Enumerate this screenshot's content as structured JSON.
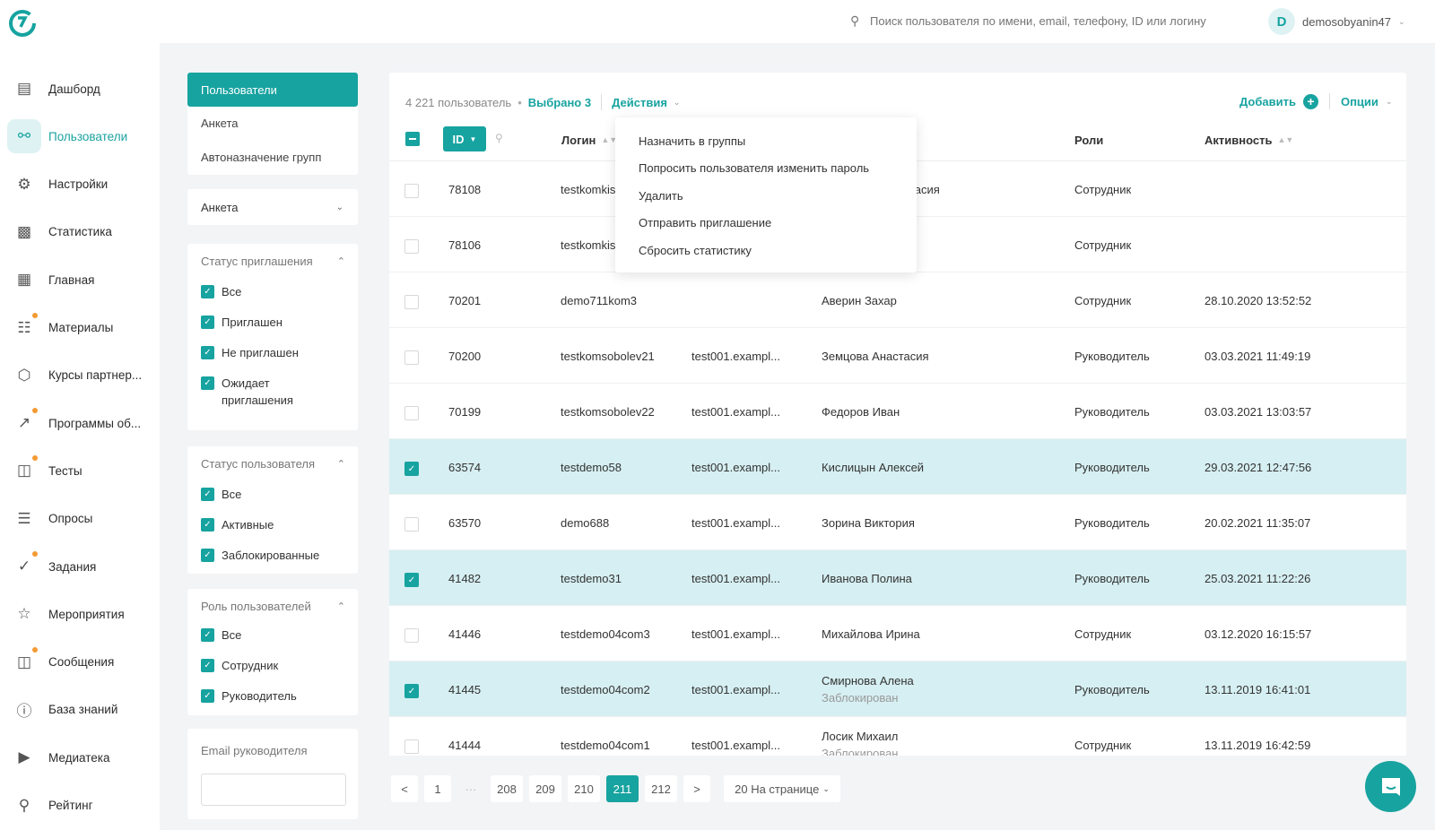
{
  "colors": {
    "accent": "#17a3a0",
    "selected_row": "#d6eff2",
    "badge_dot": "#f39a32"
  },
  "header": {
    "search_placeholder": "Поиск пользователя по имени, email, телефону, ID или логину",
    "avatar_letter": "D",
    "username": "demosobyanin47"
  },
  "sidebar": {
    "items": [
      {
        "label": "Дашборд",
        "icon": "dashboard-icon",
        "dot": false
      },
      {
        "label": "Пользователи",
        "icon": "users-icon",
        "dot": false,
        "active": true
      },
      {
        "label": "Настройки",
        "icon": "gear-icon",
        "dot": false
      },
      {
        "label": "Статистика",
        "icon": "bar-chart-icon",
        "dot": false
      },
      {
        "label": "Главная",
        "icon": "grid-icon",
        "dot": false
      },
      {
        "label": "Материалы",
        "icon": "document-icon",
        "dot": true
      },
      {
        "label": "Курсы партнер...",
        "icon": "hexagon-icon",
        "dot": false
      },
      {
        "label": "Программы об...",
        "icon": "program-icon",
        "dot": true
      },
      {
        "label": "Тесты",
        "icon": "tests-icon",
        "dot": true
      },
      {
        "label": "Опросы",
        "icon": "survey-icon",
        "dot": false
      },
      {
        "label": "Задания",
        "icon": "check-circle-icon",
        "dot": true
      },
      {
        "label": "Мероприятия",
        "icon": "calendar-icon",
        "dot": false
      },
      {
        "label": "Сообщения",
        "icon": "message-icon",
        "dot": true
      },
      {
        "label": "База знаний",
        "icon": "info-icon",
        "dot": false
      },
      {
        "label": "Медиатека",
        "icon": "media-icon",
        "dot": false
      },
      {
        "label": "Рейтинг",
        "icon": "trophy-icon",
        "dot": false
      }
    ]
  },
  "subnav": {
    "tabs": [
      "Пользователи",
      "Анкета",
      "Автоназначение групп"
    ],
    "anketa_select": "Анкета"
  },
  "filters": {
    "invite": {
      "title": "Статус приглашения",
      "options": [
        "Все",
        "Приглашен",
        "Не приглашен",
        "Ожидает приглашения"
      ]
    },
    "user_status": {
      "title": "Статус пользователя",
      "options": [
        "Все",
        "Активные",
        "Заблокированные"
      ]
    },
    "role": {
      "title": "Роль пользователей",
      "options": [
        "Все",
        "Сотрудник",
        "Руководитель"
      ]
    },
    "manager_email": {
      "label": "Email руководителя",
      "value": ""
    }
  },
  "toolbar": {
    "count": "4 221 пользователь",
    "selected": "Выбрано 3",
    "actions": "Действия",
    "add": "Добавить",
    "options": "Опции"
  },
  "actions_menu": [
    "Назначить в группы",
    "Попросить пользователя изменить пароль",
    "Удалить",
    "Отправить приглашение",
    "Сбросить статистику"
  ],
  "columns": {
    "id": "ID",
    "login": "Логин",
    "roles": "Роли",
    "activity": "Активность"
  },
  "rows": [
    {
      "id": "78108",
      "login": "testkomkis",
      "email": "",
      "name": "тасия",
      "status": "",
      "role": "Сотрудник",
      "activity": "",
      "checked": false
    },
    {
      "id": "78106",
      "login": "testkomkis",
      "email": "",
      "name": "",
      "status": "",
      "role": "Сотрудник",
      "activity": "",
      "checked": false
    },
    {
      "id": "70201",
      "login": "demo711kom3",
      "email": "",
      "name": "Аверин Захар",
      "status": "",
      "role": "Сотрудник",
      "activity": "28.10.2020 13:52:52",
      "checked": false
    },
    {
      "id": "70200",
      "login": "testkomsobolev21",
      "email": "test001.exampl...",
      "name": "Земцова Анастасия",
      "status": "",
      "role": "Руководитель",
      "activity": "03.03.2021 11:49:19",
      "checked": false
    },
    {
      "id": "70199",
      "login": "testkomsobolev22",
      "email": "test001.exampl...",
      "name": "Федоров Иван",
      "status": "",
      "role": "Руководитель",
      "activity": "03.03.2021 13:03:57",
      "checked": false
    },
    {
      "id": "63574",
      "login": "testdemo58",
      "email": "test001.exampl...",
      "name": "Кислицын Алексей",
      "status": "",
      "role": "Руководитель",
      "activity": "29.03.2021 12:47:56",
      "checked": true
    },
    {
      "id": "63570",
      "login": "demo688",
      "email": "test001.exampl...",
      "name": "Зорина Виктория",
      "status": "",
      "role": "Руководитель",
      "activity": "20.02.2021 11:35:07",
      "checked": false
    },
    {
      "id": "41482",
      "login": "testdemo31",
      "email": "test001.exampl...",
      "name": "Иванова Полина",
      "status": "",
      "role": "Руководитель",
      "activity": "25.03.2021 11:22:26",
      "checked": true
    },
    {
      "id": "41446",
      "login": "testdemo04com3",
      "email": "test001.exampl...",
      "name": "Михайлова Ирина",
      "status": "",
      "role": "Сотрудник",
      "activity": "03.12.2020 16:15:57",
      "checked": false
    },
    {
      "id": "41445",
      "login": "testdemo04com2",
      "email": "test001.exampl...",
      "name": "Смирнова Алена",
      "status": "Заблокирован",
      "role": "Руководитель",
      "activity": "13.11.2019 16:41:01",
      "checked": true
    },
    {
      "id": "41444",
      "login": "testdemo04com1",
      "email": "test001.exampl...",
      "name": "Лосик Михаил",
      "status": "Заблокирован",
      "role": "Сотрудник",
      "activity": "13.11.2019 16:42:59",
      "checked": false
    }
  ],
  "pagination": {
    "prev": "<",
    "next": ">",
    "pages": [
      "1",
      "···",
      "208",
      "209",
      "210",
      "211",
      "212"
    ],
    "current": "211",
    "per_page": "20 На странице"
  }
}
